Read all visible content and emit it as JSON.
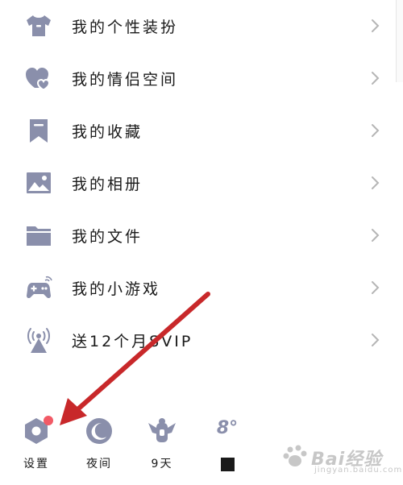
{
  "menu": {
    "items": [
      {
        "label": "我的个性装扮",
        "icon": "tshirt-icon"
      },
      {
        "label": "我的情侣空间",
        "icon": "hearts-icon"
      },
      {
        "label": "我的收藏",
        "icon": "bookmark-icon"
      },
      {
        "label": "我的相册",
        "icon": "photo-icon"
      },
      {
        "label": "我的文件",
        "icon": "folder-icon"
      },
      {
        "label": "我的小游戏",
        "icon": "gamepad-icon"
      },
      {
        "label": "送12个月SVIP",
        "icon": "broadcast-icon"
      }
    ]
  },
  "bottom_bar": {
    "settings": {
      "label": "设置",
      "icon": "settings-icon"
    },
    "night": {
      "label": "夜间",
      "icon": "moon-icon"
    },
    "weather": {
      "label": "9天",
      "icon": "weather-icon"
    },
    "temperature": {
      "value": "8°",
      "icon": "temperature-icon"
    }
  },
  "watermark": {
    "logo": "Bai经验",
    "url": "jingyan.baidu.com"
  },
  "colors": {
    "icon": "#8a8fab",
    "text": "#1a1a1a",
    "chevron": "#b5b5b5",
    "badge": "#f25a66",
    "arrow": "#c8282a"
  }
}
